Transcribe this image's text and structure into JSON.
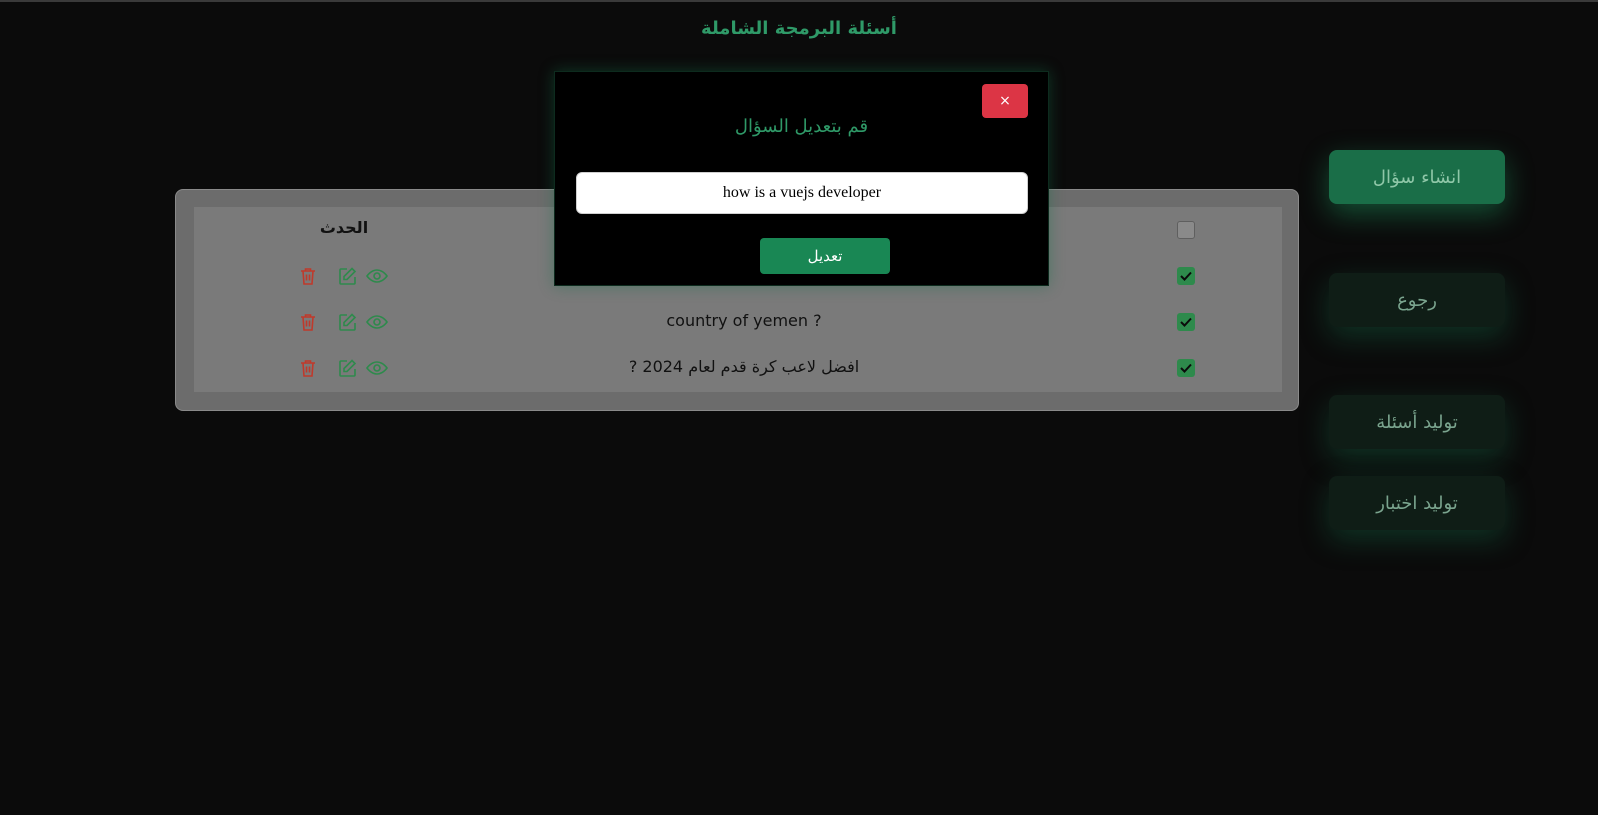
{
  "header": {
    "title": "أسئلة البرمجة الشاملة"
  },
  "sidebar": {
    "create_label": "انشاء سؤال",
    "back_label": "رجوع",
    "generate_questions_label": "توليد أسئلة",
    "generate_test_label": "توليد اختبار"
  },
  "table": {
    "header": {
      "actions_label": "الحدث"
    },
    "rows": [
      {
        "question": ""
      },
      {
        "question": "country of yemen ?"
      },
      {
        "question": "? افضل لاعب كرة قدم لعام 2024"
      }
    ]
  },
  "modal": {
    "close_label": "×",
    "title": "قم بتعديل السؤال",
    "input_value": "how is a vuejs developer",
    "submit_label": "تعديل"
  },
  "colors": {
    "accent": "#2f9a68",
    "danger": "#dc3545",
    "success": "#198754"
  },
  "icons": [
    "trash-icon",
    "edit-icon",
    "eye-icon",
    "check-icon"
  ]
}
